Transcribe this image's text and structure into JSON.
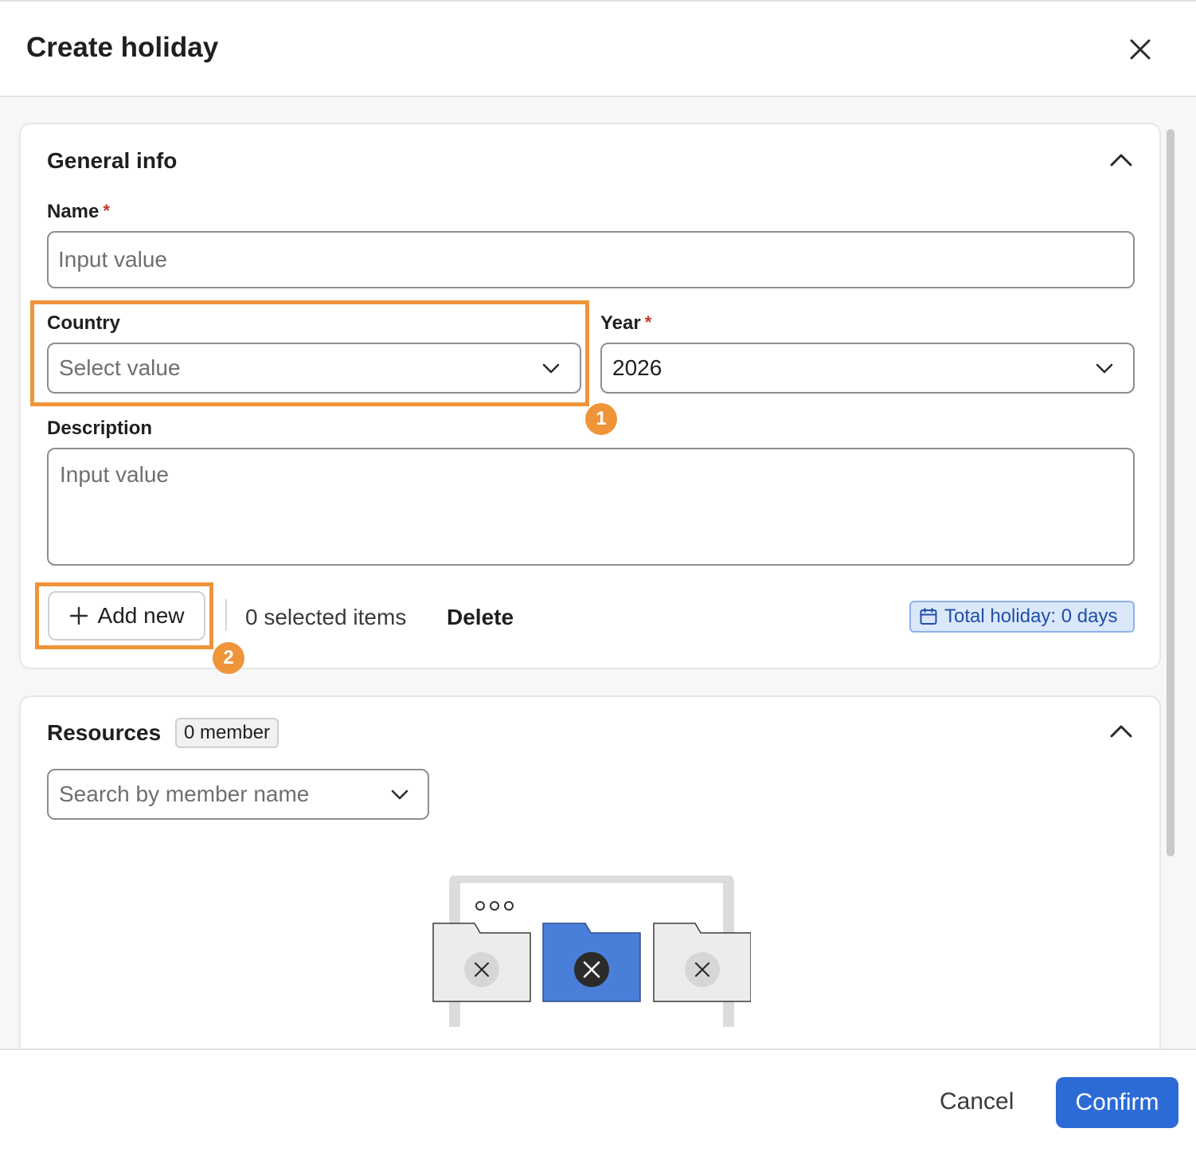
{
  "dialog": {
    "title": "Create holiday",
    "close_icon": "close-icon"
  },
  "general_info": {
    "title": "General info",
    "collapse_icon": "chevron-up-icon",
    "name": {
      "label": "Name",
      "required_mark": "*",
      "placeholder": "Input value",
      "value": ""
    },
    "country": {
      "label": "Country",
      "placeholder": "Select value",
      "value": ""
    },
    "year": {
      "label": "Year",
      "required_mark": "*",
      "value": "2026"
    },
    "description": {
      "label": "Description",
      "placeholder": "Input value",
      "value": ""
    },
    "toolbar": {
      "add_label": "Add new",
      "selected_count": "0 selected items",
      "delete_label": "Delete",
      "total_holiday": "Total holiday: 0 days"
    }
  },
  "resources": {
    "title": "Resources",
    "member_badge": "0 member",
    "collapse_icon": "chevron-up-icon",
    "search": {
      "placeholder": "Search by member name"
    },
    "empty_illustration": "empty-folders-illustration"
  },
  "annotations": {
    "step1": "1",
    "step2": "2",
    "highlight_color": "#f0943a"
  },
  "footer": {
    "cancel_label": "Cancel",
    "confirm_label": "Confirm"
  },
  "colors": {
    "primary": "#2c6bd6",
    "required": "#c0362c",
    "info_badge_bg": "#dbe7fb"
  }
}
